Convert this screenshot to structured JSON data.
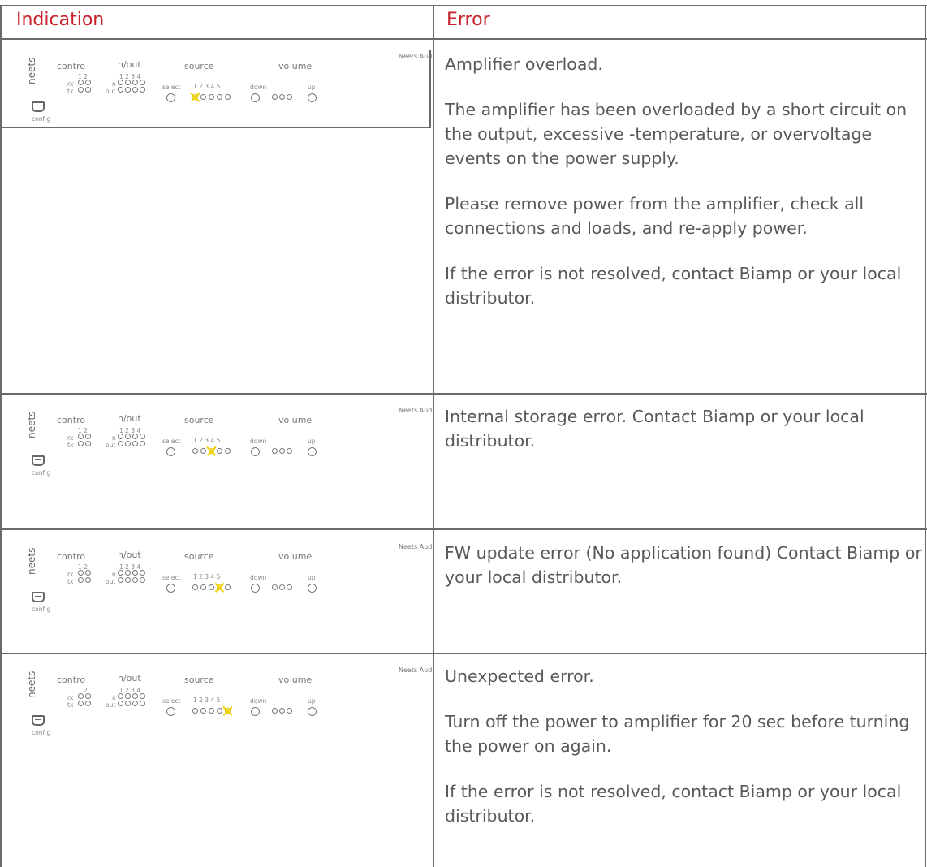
{
  "table": {
    "headers": {
      "indication": "Indication",
      "error": "Error"
    },
    "panel_labels": {
      "brand": "Neets Aud",
      "logo": "neets",
      "control": "contro",
      "inout": "n/out",
      "source": "source",
      "volume": "vo ume",
      "nums2": "1 2",
      "nums4": "1 2 3 4",
      "nums5": "1 2 3 4 5",
      "rx": "rx",
      "tx": "tx",
      "in": "n",
      "out": "out",
      "select": "se ect",
      "down": "down",
      "up": "up",
      "config": "conf g"
    },
    "rows": [
      {
        "lit_source_led": 1,
        "error_paragraphs": [
          "Amplifier overload.",
          "The amplifier has been overloaded by a short circuit on the output, excessive -temperature, or overvoltage events on the power supply.",
          "Please remove power from the amplifier, check all connections and loads, and re-apply power.",
          "If the error is not resolved, contact Biamp or your local distributor."
        ]
      },
      {
        "lit_source_led": 3,
        "error_paragraphs": [
          "Internal storage error. Contact Biamp or your local distributor."
        ]
      },
      {
        "lit_source_led": 4,
        "error_paragraphs": [
          "FW update error (No application found) Contact Biamp or your local distributor."
        ]
      },
      {
        "lit_source_led": 5,
        "error_paragraphs": [
          "Unexpected error.",
          "Turn off the power to amplifier for 20 sec before turning the power on again.",
          "If the error is not resolved, contact Biamp or your local distributor."
        ]
      }
    ]
  }
}
